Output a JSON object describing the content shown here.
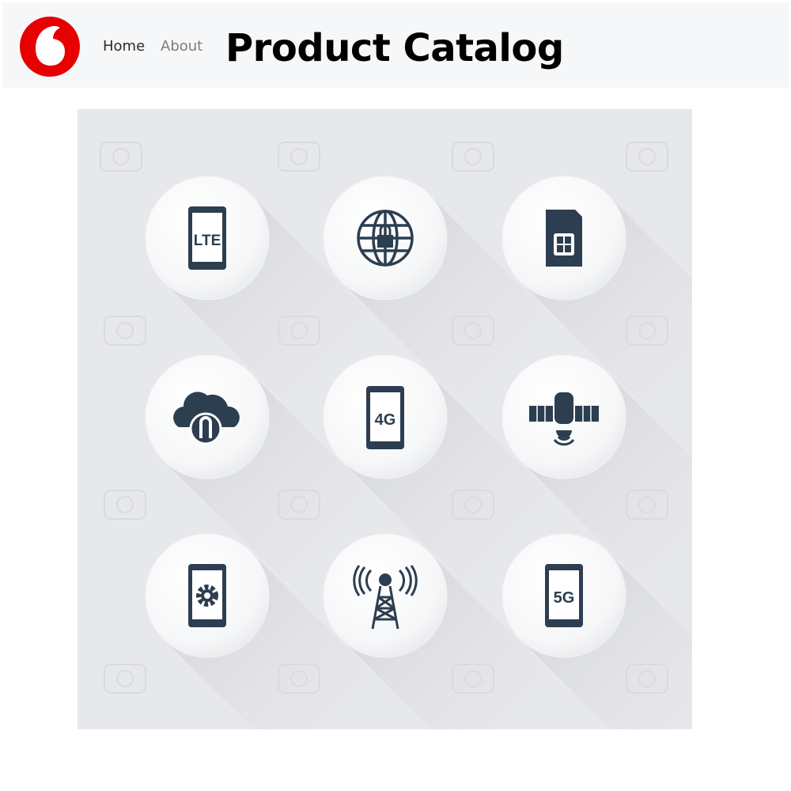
{
  "header": {
    "logo_icon": "vodafone-speechmark-logo-icon",
    "brand_color": "#e60000",
    "nav": [
      {
        "label": "Home"
      },
      {
        "label": "About"
      }
    ],
    "title": "Product Catalog"
  },
  "catalog": {
    "background": "#e7e8eb",
    "watermark_text": "123RF",
    "icons": [
      {
        "name": "lte-phone-icon",
        "label": "LTE"
      },
      {
        "name": "secure-globe-icon"
      },
      {
        "name": "sim-card-icon"
      },
      {
        "name": "cloud-upload-icon"
      },
      {
        "name": "4g-phone-icon",
        "label": "4G"
      },
      {
        "name": "satellite-icon"
      },
      {
        "name": "phone-settings-icon"
      },
      {
        "name": "radio-tower-icon"
      },
      {
        "name": "5g-phone-icon",
        "label": "5G"
      }
    ],
    "icon_color": "#2c3e50"
  }
}
